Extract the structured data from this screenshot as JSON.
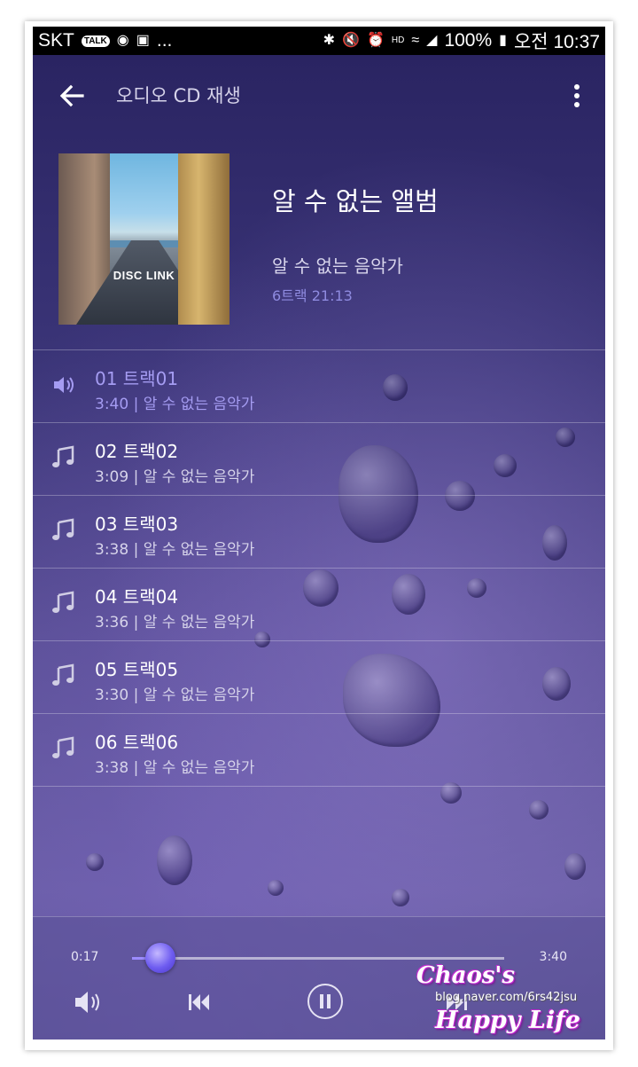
{
  "status_bar": {
    "carrier": "SKT",
    "more": "...",
    "battery": "100%",
    "time": "오전 10:37"
  },
  "app_bar": {
    "title": "오디오 CD 재생"
  },
  "album": {
    "art_label": "DISC LINK",
    "title": "알 수 없는 앨범",
    "artist": "알 수 없는 음악가",
    "meta": "6트랙 21:13"
  },
  "tracks": [
    {
      "name": "01  트랙01",
      "sub": "3:40 | 알 수 없는 음악가",
      "active": true
    },
    {
      "name": "02  트랙02",
      "sub": "3:09 | 알 수 없는 음악가",
      "active": false
    },
    {
      "name": "03  트랙03",
      "sub": "3:38 | 알 수 없는 음악가",
      "active": false
    },
    {
      "name": "04  트랙04",
      "sub": "3:36 | 알 수 없는 음악가",
      "active": false
    },
    {
      "name": "05  트랙05",
      "sub": "3:30 | 알 수 없는 음악가",
      "active": false
    },
    {
      "name": "06  트랙06",
      "sub": "3:38 | 알 수 없는 음악가",
      "active": false
    }
  ],
  "player": {
    "current_time": "0:17",
    "total_time": "3:40",
    "progress": 0.077
  },
  "watermark": {
    "line1": "Chaos's",
    "line2": "blog.naver.com/6rs42jsu",
    "line3": "Happy Life"
  },
  "colors": {
    "accent": "#a59cf2",
    "background": "#3a3477"
  }
}
